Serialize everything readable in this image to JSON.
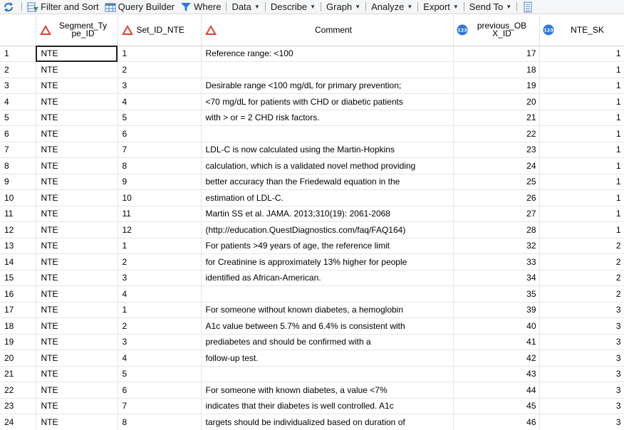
{
  "toolbar": {
    "items": [
      {
        "label": "Filter and Sort",
        "icon": "filter-sort-icon",
        "caret": false
      },
      {
        "label": "Query Builder",
        "icon": "query-builder-icon",
        "caret": false
      },
      {
        "label": "Where",
        "icon": "funnel-icon",
        "caret": false
      },
      {
        "label": "Data",
        "caret": true
      },
      {
        "label": "Describe",
        "caret": true
      },
      {
        "label": "Graph",
        "caret": true
      },
      {
        "label": "Analyze",
        "caret": true
      },
      {
        "label": "Export",
        "caret": true
      },
      {
        "label": "Send To",
        "caret": true
      }
    ]
  },
  "table": {
    "columns": [
      {
        "key": "segment_type_id",
        "line1": "Segment_Ty",
        "line2": "pe_ID",
        "type": "character"
      },
      {
        "key": "set_id_nte",
        "line1": "Set_ID_NTE",
        "line2": "",
        "type": "character"
      },
      {
        "key": "comment",
        "line1": "Comment",
        "line2": "",
        "type": "character"
      },
      {
        "key": "previous_obx_id",
        "line1": "previous_OB",
        "line2": "X_ID",
        "type": "numeric"
      },
      {
        "key": "nte_sk",
        "line1": "NTE_SK",
        "line2": "",
        "type": "numeric"
      }
    ],
    "rows": [
      [
        "1",
        "NTE",
        "1",
        "Reference range: <100",
        "17",
        "1"
      ],
      [
        "2",
        "NTE",
        "2",
        "",
        "18",
        "1"
      ],
      [
        "3",
        "NTE",
        "3",
        "Desirable range <100 mg/dL for primary prevention;",
        "19",
        "1"
      ],
      [
        "4",
        "NTE",
        "4",
        "<70 mg/dL for patients with CHD or diabetic patients",
        "20",
        "1"
      ],
      [
        "5",
        "NTE",
        "5",
        "with > or = 2 CHD risk factors.",
        "21",
        "1"
      ],
      [
        "6",
        "NTE",
        "6",
        "",
        "22",
        "1"
      ],
      [
        "7",
        "NTE",
        "7",
        "LDL-C is now calculated using the Martin-Hopkins",
        "23",
        "1"
      ],
      [
        "8",
        "NTE",
        "8",
        "calculation, which is a validated novel method providing",
        "24",
        "1"
      ],
      [
        "9",
        "NTE",
        "9",
        "better accuracy than the Friedewald equation in the",
        "25",
        "1"
      ],
      [
        "10",
        "NTE",
        "10",
        "estimation of LDL-C.",
        "26",
        "1"
      ],
      [
        "11",
        "NTE",
        "11",
        "Martin SS et al. JAMA. 2013;310(19): 2061-2068",
        "27",
        "1"
      ],
      [
        "12",
        "NTE",
        "12",
        "(http://education.QuestDiagnostics.com/faq/FAQ164)",
        "28",
        "1"
      ],
      [
        "13",
        "NTE",
        "1",
        "For patients >49 years of age, the reference limit",
        "32",
        "2"
      ],
      [
        "14",
        "NTE",
        "2",
        "for Creatinine is approximately 13% higher for people",
        "33",
        "2"
      ],
      [
        "15",
        "NTE",
        "3",
        "identified as African-American.",
        "34",
        "2"
      ],
      [
        "16",
        "NTE",
        "4",
        "",
        "35",
        "2"
      ],
      [
        "17",
        "NTE",
        "1",
        "For someone without known diabetes, a hemoglobin",
        "39",
        "3"
      ],
      [
        "18",
        "NTE",
        "2",
        "A1c value between 5.7% and 6.4% is consistent with",
        "40",
        "3"
      ],
      [
        "19",
        "NTE",
        "3",
        "prediabetes and should be confirmed with a",
        "41",
        "3"
      ],
      [
        "20",
        "NTE",
        "4",
        "follow-up test.",
        "42",
        "3"
      ],
      [
        "21",
        "NTE",
        "5",
        "",
        "43",
        "3"
      ],
      [
        "22",
        "NTE",
        "6",
        "For someone with known diabetes, a value <7%",
        "44",
        "3"
      ],
      [
        "23",
        "NTE",
        "7",
        "indicates that their diabetes is well controlled. A1c",
        "45",
        "3"
      ],
      [
        "24",
        "NTE",
        "8",
        "targets should be individualized based on duration of",
        "46",
        "3"
      ]
    ]
  },
  "colors": {
    "char_icon_red": "#e0413a",
    "num_icon_blue": "#2f79d6"
  }
}
